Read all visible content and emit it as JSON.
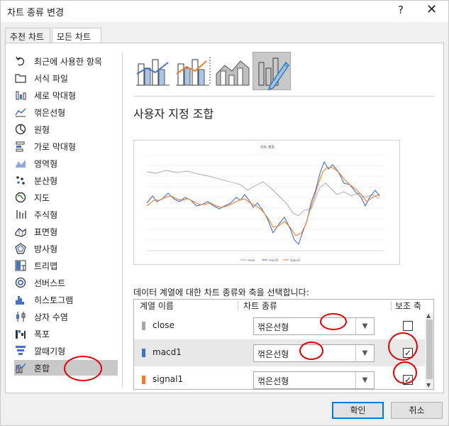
{
  "window": {
    "title": "차트 종류 변경",
    "help": "?",
    "close": "✕"
  },
  "tabs": [
    {
      "label": "추천 차트"
    },
    {
      "label": "모든 차트"
    }
  ],
  "categories": [
    {
      "label": "최근에 사용한 항목",
      "icon": "undo-icon"
    },
    {
      "label": "서식 파일",
      "icon": "folder-icon"
    },
    {
      "label": "세로 막대형",
      "icon": "column-chart-icon"
    },
    {
      "label": "꺾은선형",
      "icon": "line-chart-icon"
    },
    {
      "label": "원형",
      "icon": "pie-chart-icon"
    },
    {
      "label": "가로 막대형",
      "icon": "bar-chart-icon"
    },
    {
      "label": "영역형",
      "icon": "area-chart-icon"
    },
    {
      "label": "분산형",
      "icon": "scatter-chart-icon"
    },
    {
      "label": "지도",
      "icon": "map-chart-icon"
    },
    {
      "label": "주식형",
      "icon": "stock-chart-icon"
    },
    {
      "label": "표면형",
      "icon": "surface-chart-icon"
    },
    {
      "label": "방사형",
      "icon": "radar-chart-icon"
    },
    {
      "label": "트리맵",
      "icon": "treemap-chart-icon"
    },
    {
      "label": "선버스트",
      "icon": "sunburst-chart-icon"
    },
    {
      "label": "히스토그램",
      "icon": "histogram-chart-icon"
    },
    {
      "label": "상자 수염",
      "icon": "box-whisker-chart-icon"
    },
    {
      "label": "폭포",
      "icon": "waterfall-chart-icon"
    },
    {
      "label": "깔때기형",
      "icon": "funnel-chart-icon"
    },
    {
      "label": "혼합",
      "icon": "combo-chart-icon"
    }
  ],
  "selected_category": "혼합",
  "main": {
    "combo_title": "사용자 지정 조합",
    "series_prompt": "데이터 계열에 대한 차트 종류와 축을 선택합니다:",
    "grid_headers": {
      "name": "계열 이름",
      "type": "차트 종류",
      "axis": "보조 축"
    },
    "series": [
      {
        "name": "close",
        "color": "#a6a6a6",
        "type": "꺾은선형",
        "secondary_axis": false,
        "check_mark": ""
      },
      {
        "name": "macd1",
        "color": "#4472c4",
        "type": "꺾은선형",
        "secondary_axis": true,
        "check_mark": "✓"
      },
      {
        "name": "signal1",
        "color": "#ed7d31",
        "type": "꺾은선형",
        "secondary_axis": true,
        "check_mark": "✓"
      }
    ]
  },
  "preview": {
    "title": "차트 제목"
  },
  "buttons": {
    "ok": "확인",
    "cancel": "취소"
  },
  "colors": {
    "annotation": "#e00000",
    "selection": "#c8c8c8",
    "accent": "#0078d7"
  }
}
